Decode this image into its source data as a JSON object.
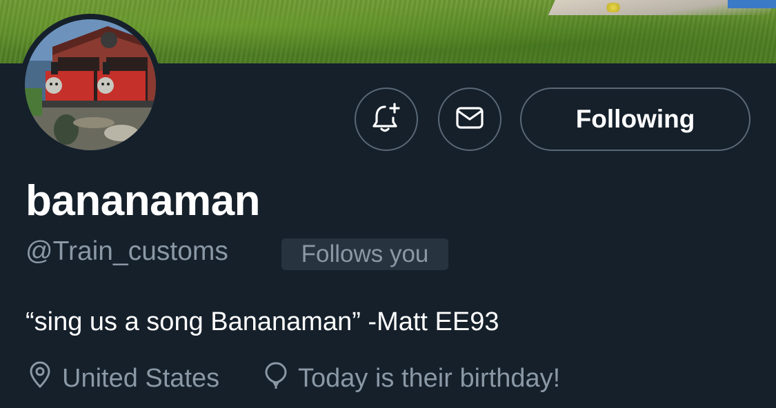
{
  "profile": {
    "display_name": "bananaman",
    "handle": "@Train_customs",
    "follows_you_label": "Follows you",
    "bio": "“sing us a song Bananaman” -Matt EE93",
    "location": "United States",
    "birthday_note": "Today is their birthday!"
  },
  "actions": {
    "following_label": "Following",
    "notify_icon": "bell-plus-icon",
    "message_icon": "envelope-icon"
  },
  "icons": {
    "location": "map-pin-icon",
    "birthday": "balloon-icon"
  },
  "colors": {
    "background": "#15202b",
    "primary_text": "#ffffff",
    "secondary_text": "#8b98a5",
    "button_border": "#5b6876",
    "badge_bg": "#283340"
  }
}
